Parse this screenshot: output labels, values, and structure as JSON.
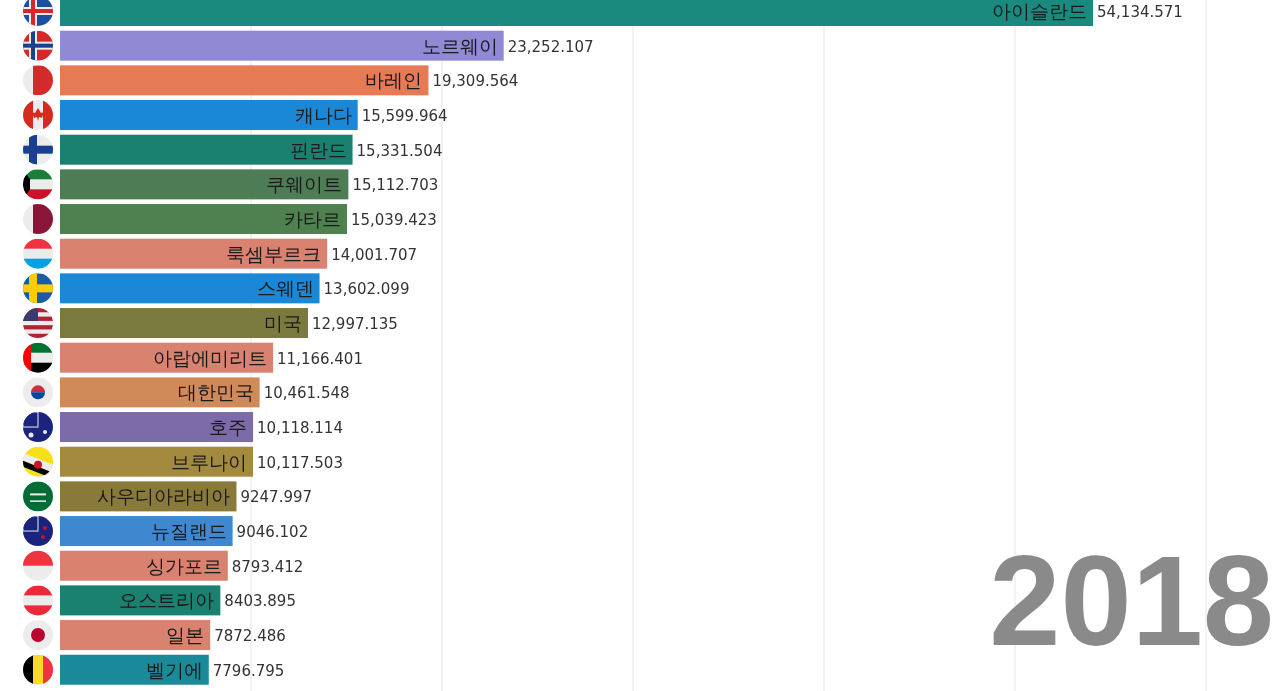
{
  "chart": {
    "chart_data": {
      "type": "bar",
      "orientation": "horizontal",
      "data_labels": true,
      "categories": [
        "아이슬란드",
        "노르웨이",
        "바레인",
        "캐나다",
        "핀란드",
        "쿠웨이트",
        "카타르",
        "룩셈부르크",
        "스웨덴",
        "미국",
        "아랍에미리트",
        "대한민국",
        "호주",
        "브루나이",
        "사우디아라비아",
        "뉴질랜드",
        "싱가포르",
        "오스트리아",
        "일본",
        "벨기에"
      ],
      "values": [
        54134.571,
        23252.107,
        19309.564,
        15599.964,
        15331.504,
        15112.703,
        15039.423,
        14001.707,
        13602.099,
        12997.135,
        11166.401,
        10461.548,
        10118.114,
        10117.503,
        9247.997,
        9046.102,
        8793.412,
        8403.895,
        7872.486,
        7796.795
      ],
      "value_labels": [
        "54,134.571",
        "23,252.107",
        "19,309.564",
        "15,599.964",
        "15,331.504",
        "15,112.703",
        "15,039.423",
        "14,001.707",
        "13,602.099",
        "12,997.135",
        "11,166.401",
        "10,461.548",
        "10,118.114",
        "10,117.503",
        "9247.997",
        "9046.102",
        "8793.412",
        "8403.895",
        "7872.486",
        "7796.795"
      ]
    },
    "bars": [
      {
        "color": "#1a8a7e"
      },
      {
        "color": "#9089d4"
      },
      {
        "color": "#e57a55"
      },
      {
        "color": "#1a88d6"
      },
      {
        "color": "#1a8070"
      },
      {
        "color": "#4e7d55"
      },
      {
        "color": "#4e8050"
      },
      {
        "color": "#d9826f"
      },
      {
        "color": "#1a88d6"
      },
      {
        "color": "#7a7a3f"
      },
      {
        "color": "#d9826f"
      },
      {
        "color": "#d08a5a"
      },
      {
        "color": "#7b6ba8"
      },
      {
        "color": "#a48a3f"
      },
      {
        "color": "#8a7a3a"
      },
      {
        "color": "#3f88d0"
      },
      {
        "color": "#d9826f"
      },
      {
        "color": "#1a8070"
      },
      {
        "color": "#d9826f"
      },
      {
        "color": "#1a8a9a"
      }
    ]
  },
  "year": "2018"
}
